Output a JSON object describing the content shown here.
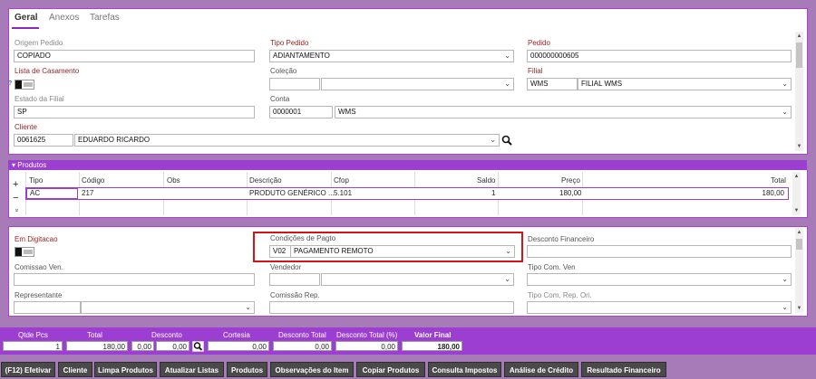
{
  "tabs": [
    "Geral",
    "Anexos",
    "Tarefas"
  ],
  "general": {
    "origem_pedido": {
      "label": "Origem Pedido",
      "value": "COPIADO"
    },
    "tipo_pedido": {
      "label": "Tipo Pedido",
      "value": "ADIANTAMENTO"
    },
    "pedido": {
      "label": "Pedido",
      "value": "000000000605"
    },
    "lista_casamento": {
      "label": "Lista de Casamento",
      "help": "?"
    },
    "colecao": {
      "label": "Coleção",
      "code": "",
      "value": ""
    },
    "filial": {
      "label": "Filial",
      "code": "WMS",
      "value": "FILIAL WMS"
    },
    "estado_filial": {
      "label": "Estado da Filial",
      "value": "SP"
    },
    "conta": {
      "label": "Conta",
      "code": "0000001",
      "value": "WMS"
    },
    "cliente": {
      "label": "Cliente",
      "code": "0061625",
      "value": "EDUARDO RICARDO"
    }
  },
  "produtos": {
    "title": "Produtos",
    "columns": [
      "Tipo",
      "Código",
      "Obs",
      "Descrição",
      "Cfop",
      "Saldo",
      "Preço",
      "Total"
    ],
    "rows": [
      {
        "tipo": "AC",
        "codigo": "217",
        "obs": "",
        "descricao": "PRODUTO GENÉRICO ...",
        "cfop": "5.101",
        "saldo": "1",
        "preco": "180,00",
        "total": "180,00"
      }
    ],
    "add": "+",
    "remove": "−",
    "expand": "»"
  },
  "details": {
    "status": "Em Digitacao",
    "condicoes": {
      "label": "Condições de Pagto",
      "code": "V02",
      "value": "PAGAMENTO REMOTO"
    },
    "desconto_financeiro": {
      "label": "Desconto Financeiro",
      "value": ""
    },
    "comissao_ven": {
      "label": "Comissao Ven.",
      "value": ""
    },
    "vendedor": {
      "label": "Vendedor",
      "code": "",
      "value": ""
    },
    "tipo_com_ven": {
      "label": "Tipo Com. Ven",
      "value": ""
    },
    "representante": {
      "label": "Representante",
      "code": "",
      "value": ""
    },
    "comissao_rep": {
      "label": "Comissão Rep.",
      "value": ""
    },
    "tipo_com_rep_ori": {
      "label": "Tipo Com. Rep. Ori.",
      "value": ""
    }
  },
  "totals": {
    "qtde_pcs": {
      "label": "Qtde Pcs",
      "value": "1"
    },
    "total": {
      "label": "Total",
      "value": "180,00"
    },
    "desconto": {
      "label": "Desconto",
      "pct": "0,00",
      "value": "0,00"
    },
    "cortesia": {
      "label": "Cortesia",
      "value": "0,00"
    },
    "desconto_total": {
      "label": "Desconto Total",
      "value": "0,00"
    },
    "desconto_total_pct": {
      "label": "Desconto Total (%)",
      "value": "0,00"
    },
    "valor_final": {
      "label": "Valor Final",
      "value": "180,00"
    }
  },
  "buttons": [
    "(F12) Efetivar",
    "Cliente",
    "Limpa Produtos",
    "Atualizar Listas",
    "Produtos",
    "Observações do Item",
    "Copiar Produtos",
    "Consulta Impostos",
    "Análise de Crédito",
    "Resultado Financeiro"
  ],
  "colors": {
    "accent": "#9b3ed1",
    "background": "#a77ab8",
    "highlight": "#d41414"
  }
}
